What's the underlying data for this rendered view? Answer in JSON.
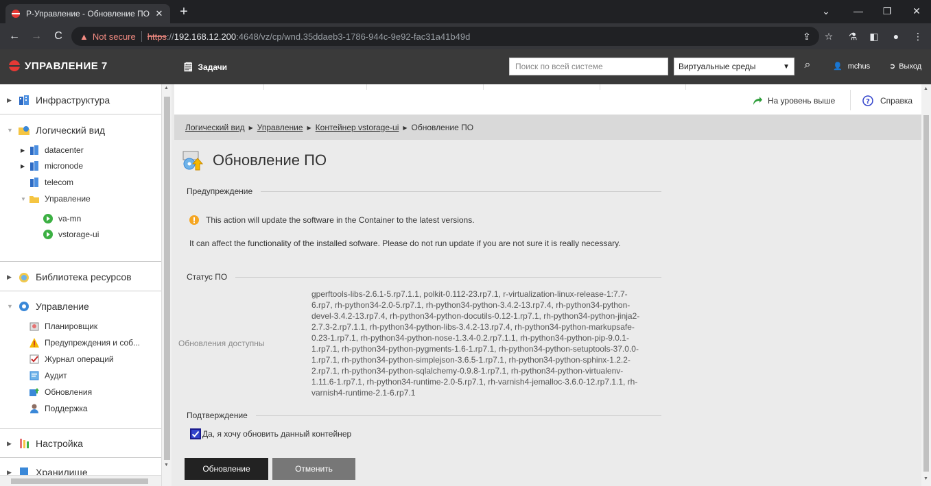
{
  "browser": {
    "tab_title": "Р-Управление - Обновление ПО",
    "new_tab": "+",
    "not_secure": "Not secure",
    "url_scheme": "https",
    "url_sep": "://",
    "url_host": "192.168.12.200",
    "url_rest": ":4648/vz/cp/wnd.35ddaeb3-1786-944c-9e92-fac31a41b49d"
  },
  "header": {
    "logo_text": "УПРАВЛЕНИЕ 7",
    "tasks_label": "Задачи",
    "search_placeholder": "Поиск по всей системе",
    "scope_value": "Виртуальные среды",
    "user_name": "mchus",
    "logout_label": "Выход"
  },
  "sidebar": {
    "infra": "Инфраструктура",
    "logical_view": "Логический вид",
    "logical_items": {
      "datacenter": "datacenter",
      "micronode": "micronode",
      "telecom": "telecom",
      "management": "Управление",
      "va_mn": "va-mn",
      "vstorage_ui": "vstorage-ui"
    },
    "resource_library": "Библиотека ресурсов",
    "management": "Управление",
    "management_items": {
      "scheduler": "Планировщик",
      "alerts": "Предупреждения и соб...",
      "oplog": "Журнал операций",
      "audit": "Аудит",
      "updates": "Обновления",
      "support": "Поддержка"
    },
    "settings": "Настройка",
    "storage": "Хранилище"
  },
  "actions": {
    "up_level": "На уровень выше",
    "help": "Справка"
  },
  "breadcrumb": {
    "b1": "Логический вид",
    "b2": "Управление",
    "b3": "Контейнер vstorage-ui",
    "b4": "Обновление ПО"
  },
  "page": {
    "title": "Обновление ПО",
    "warning_head": "Предупреждение",
    "warning_line1": "This action will update the software in the Container to the latest versions.",
    "warning_line2": "It can affect the functionality of the installed sofware. Please do not run update if you are not sure it is really necessary.",
    "status_head": "Статус ПО",
    "updates_label": "Обновления доступны",
    "updates_lines": [
      "gperftools-libs-2.6.1-5.rp7.1.1, polkit-0.112-23.rp7.1, r-virtualization-linux-release-1:7.7-",
      "6.rp7, rh-python34-2.0-5.rp7.1, rh-python34-python-3.4.2-13.rp7.4, rh-python34-python-",
      "devel-3.4.2-13.rp7.4, rh-python34-python-docutils-0.12-1.rp7.1, rh-python34-python-jinja2-",
      "2.7.3-2.rp7.1.1, rh-python34-python-libs-3.4.2-13.rp7.4, rh-python34-python-markupsafe-",
      "0.23-1.rp7.1, rh-python34-python-nose-1.3.4-0.2.rp7.1.1, rh-python34-python-pip-9.0.1-",
      "1.rp7.1, rh-python34-python-pygments-1.6-1.rp7.1, rh-python34-python-setuptools-37.0.0-",
      "1.rp7.1, rh-python34-python-simplejson-3.6.5-1.rp7.1, rh-python34-python-sphinx-1.2.2-",
      "2.rp7.1, rh-python34-python-sqlalchemy-0.9.8-1.rp7.1, rh-python34-python-virtualenv-",
      "1.11.6-1.rp7.1, rh-python34-runtime-2.0-5.rp7.1, rh-varnish4-jemalloc-3.6.0-12.rp7.1.1, rh-",
      "varnish4-runtime-2.1-6.rp7.1"
    ],
    "confirm_head": "Подтверждение",
    "confirm_label": "Да, я хочу обновить данный контейнер",
    "update_button": "Обновление",
    "cancel_button": "Отменить"
  },
  "colors": {
    "header_bg": "#3a3a3a",
    "breadcrumb_bg": "#d9d9d9",
    "primary_button": "#222222",
    "secondary_button": "#777777",
    "brand_red": "#e53935"
  }
}
